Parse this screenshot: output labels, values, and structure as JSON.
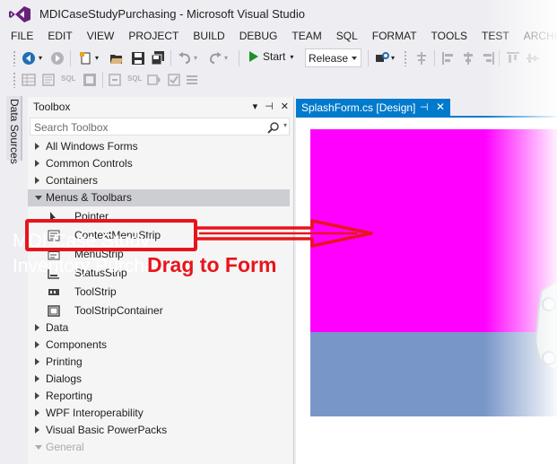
{
  "window": {
    "title": "MDICaseStudyPurchasing - Microsoft Visual Studio"
  },
  "menu": [
    "FILE",
    "EDIT",
    "VIEW",
    "PROJECT",
    "BUILD",
    "DEBUG",
    "TEAM",
    "SQL",
    "FORMAT",
    "TOOLS",
    "TEST",
    "ARCHI"
  ],
  "toolbar": {
    "start_label": "Start",
    "configuration": "Release"
  },
  "side_tab": {
    "label": "Data Sources"
  },
  "toolbox": {
    "title": "Toolbox",
    "search_placeholder": "Search Toolbox",
    "groups_before": [
      "All Windows Forms",
      "Common Controls",
      "Containers"
    ],
    "expanded_group": "Menus & Toolbars",
    "items": [
      "Pointer",
      "ContextMenuStrip",
      "MenuStrip",
      "StatusStrip",
      "ToolStrip",
      "ToolStripContainer"
    ],
    "groups_after": [
      "Data",
      "Components",
      "Printing",
      "Dialogs",
      "Reporting",
      "WPF Interoperability",
      "Visual Basic PowerPacks",
      "General"
    ]
  },
  "document_tab": {
    "label": "SplashForm.cs [Design]"
  },
  "splash": {
    "line1": "MDI Case Study",
    "line2": "Inventory Purchasing",
    "top_color": "#ff00ff",
    "bottom_color": "#7996c8"
  },
  "annotation": {
    "label": "Drag to Form",
    "color": "#e8141b"
  },
  "colors": {
    "accent": "#007acc",
    "background": "#eeeef2"
  }
}
